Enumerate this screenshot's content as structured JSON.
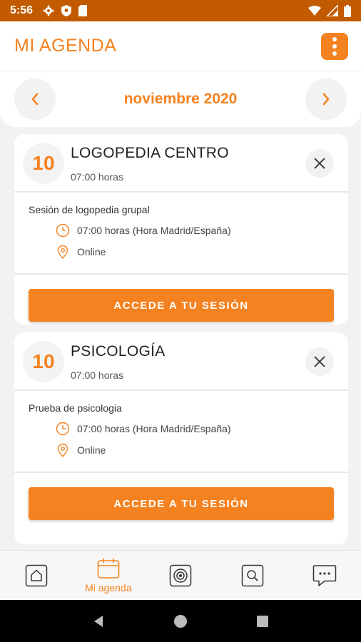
{
  "status_bar": {
    "time": "5:56"
  },
  "header": {
    "title": "MI AGENDA"
  },
  "month_nav": {
    "prev": "‹",
    "next": "›",
    "month": "noviembre 2020"
  },
  "sessions": [
    {
      "day": "10",
      "title": "LOGOPEDIA CENTRO",
      "time": "07:00 horas",
      "description": "Sesión de logopedia grupal",
      "time_detail": "07:00 horas (Hora Madrid/España)",
      "location": "Online",
      "button": "ACCEDE A TU SESIÓN"
    },
    {
      "day": "10",
      "title": "PSICOLOGÍA",
      "time": "07:00 horas",
      "description": "Prueba de psicologia",
      "time_detail": "07:00 horas (Hora Madrid/España)",
      "location": "Online",
      "button": "ACCEDE A TU SESIÓN"
    }
  ],
  "bottom_nav": {
    "items": [
      {
        "icon": "home-icon",
        "label": ""
      },
      {
        "icon": "calendar-icon",
        "label": "Mi agenda",
        "active": true
      },
      {
        "icon": "target-icon",
        "label": ""
      },
      {
        "icon": "search-icon",
        "label": ""
      },
      {
        "icon": "chat-icon",
        "label": ""
      }
    ]
  },
  "colors": {
    "accent": "#f58220",
    "status_bar": "#c25a00"
  }
}
